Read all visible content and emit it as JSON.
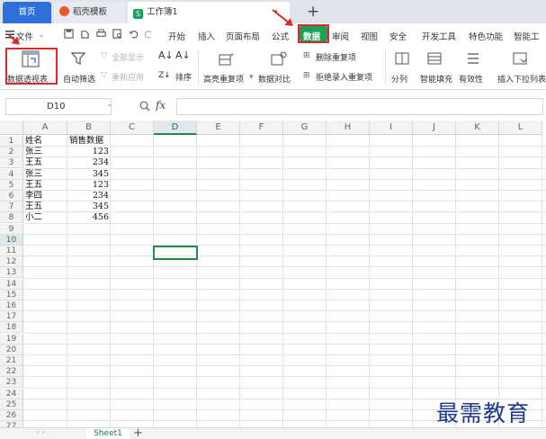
{
  "tabs": {
    "home": "首页",
    "template": "稻壳模板",
    "workbook": "工作簿1",
    "workbook_icon": "S"
  },
  "menu": {
    "file": "文件",
    "items": [
      "开始",
      "插入",
      "页面布局",
      "公式",
      "数据",
      "审阅",
      "视图",
      "安全",
      "开发工具",
      "特色功能",
      "智能工"
    ]
  },
  "ribbon": {
    "pivot": "数据透视表",
    "auto_filter": "自动筛选",
    "show_all": "全部显示",
    "reapply": "重新应用",
    "sort": "排序",
    "highlight_dup": "高亮重复项",
    "data_compare": "数据对比",
    "delete_dup": "删除重复项",
    "reject_dup": "拒绝录入重复项",
    "split": "分列",
    "smart_fill": "智能填充",
    "validity": "有效性",
    "dropdown": "插入下拉列表"
  },
  "formula_bar": {
    "cell_ref": "D10",
    "fx": "fx"
  },
  "columns": [
    "A",
    "B",
    "C",
    "D",
    "E",
    "F",
    "G",
    "H",
    "I",
    "J",
    "K",
    "L"
  ],
  "active": {
    "column": "D",
    "row": 10
  },
  "table": {
    "headers": [
      "姓名",
      "销售数据"
    ],
    "rows": [
      [
        "张三",
        "123"
      ],
      [
        "王五",
        "234"
      ],
      [
        "张三",
        "345"
      ],
      [
        "王五",
        "123"
      ],
      [
        "李四",
        "234"
      ],
      [
        "王五",
        "345"
      ],
      [
        "小二",
        "456"
      ]
    ]
  },
  "sheet": {
    "name": "Sheet1"
  },
  "watermark": "最需教育",
  "colors": {
    "accent_green": "#1d8a4c",
    "highlight_red": "#d42a2a",
    "home_tab_blue": "#2f6fdc"
  },
  "icons": [
    "file-menu-icon",
    "save-icon",
    "print-icon",
    "undo-icon",
    "redo-icon",
    "pivot-table-icon",
    "filter-icon",
    "sort-icon",
    "search-zoom-icon"
  ]
}
